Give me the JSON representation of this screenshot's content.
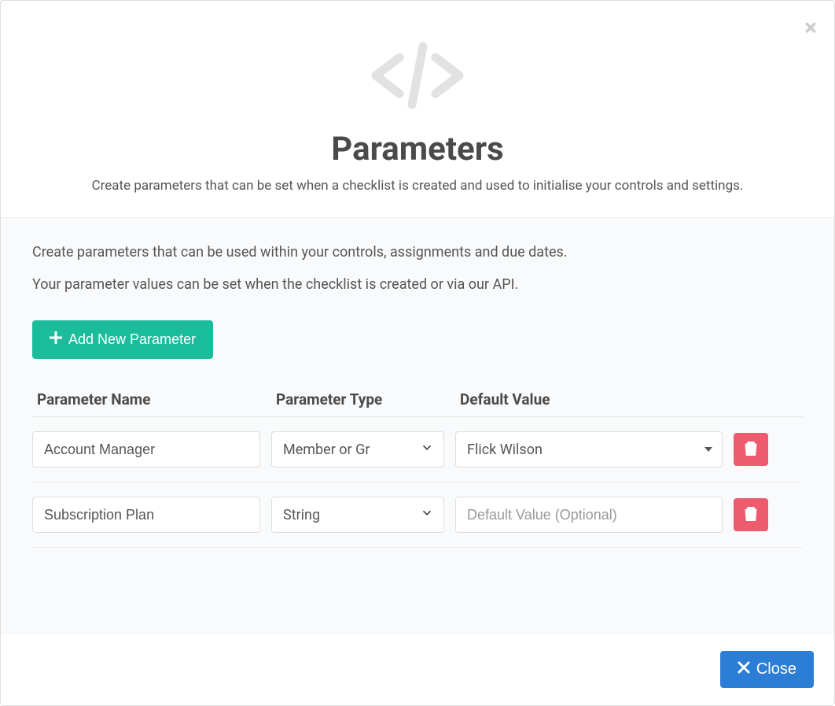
{
  "header": {
    "title": "Parameters",
    "subtitle": "Create parameters that can be set when a checklist is created and used to initialise your controls and settings."
  },
  "body": {
    "intro_line1": "Create parameters that can be used within your controls, assignments and due dates.",
    "intro_line2": "Your parameter values can be set when the checklist is created or via our API.",
    "add_button_label": "Add New Parameter",
    "columns": {
      "name": "Parameter Name",
      "type": "Parameter Type",
      "default": "Default Value"
    },
    "default_placeholder": "Default Value (Optional)",
    "rows": [
      {
        "name": "Account Manager",
        "type": "Member or Gr",
        "default_value": "Flick Wilson",
        "default_kind": "dropdown"
      },
      {
        "name": "Subscription Plan",
        "type": "String",
        "default_value": "",
        "default_kind": "text"
      }
    ]
  },
  "footer": {
    "close_label": "Close"
  }
}
